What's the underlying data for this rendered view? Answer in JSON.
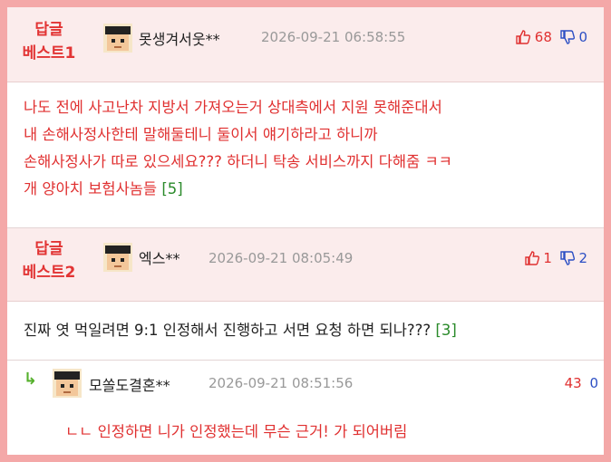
{
  "comments": [
    {
      "best_label_1": "답글",
      "best_label_2": "베스트1",
      "nickname": "못생겨서웃**",
      "date": "2026-09-21 06:58:55",
      "up": "68",
      "down": "0",
      "lines": [
        "나도 전에 사고난차 지방서 가져오는거 상대측에서 지원 못해준대서",
        "내 손해사정사한테 말해둘테니 둘이서 얘기하라고 하니까",
        "손해사정사가 따로 있으세요??? 하더니 탁송 서비스까지 다해줌 ㅋㅋ",
        "개 양아치 보험사놈들"
      ],
      "reply_count": "[5]"
    },
    {
      "best_label_1": "답글",
      "best_label_2": "베스트2",
      "nickname": "엑스**",
      "date": "2026-09-21 08:05:49",
      "up": "1",
      "down": "2",
      "text": "진짜 엿 먹일려면 9:1 인정해서 진행하고 서면 요청 하면 되나???",
      "reply_count": "[3]"
    }
  ],
  "reply": {
    "arrow": "↳",
    "nickname": "모쏠도결혼**",
    "date": "2026-09-21 08:51:56",
    "up": "43",
    "down": "0",
    "text": "ㄴㄴ 인정하면 니가 인정했는데 무슨 근거! 가 되어버림"
  },
  "colors": {
    "best_red": "#e23434",
    "body_red": "#e03030",
    "count_green": "#2a8a2a",
    "down_blue": "#2c4fc4",
    "frame_pink": "#f4a8a8"
  }
}
